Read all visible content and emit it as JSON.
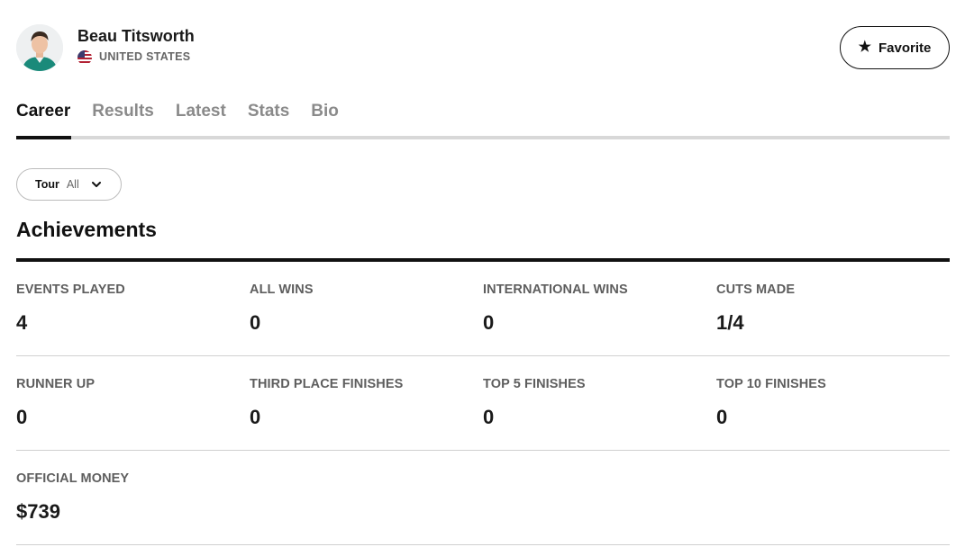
{
  "player": {
    "name": "Beau Titsworth",
    "country": "UNITED STATES"
  },
  "actions": {
    "favorite_label": "Favorite"
  },
  "tabs": [
    {
      "label": "Career",
      "active": true
    },
    {
      "label": "Results",
      "active": false
    },
    {
      "label": "Latest",
      "active": false
    },
    {
      "label": "Stats",
      "active": false
    },
    {
      "label": "Bio",
      "active": false
    }
  ],
  "filter": {
    "label": "Tour",
    "value": "All"
  },
  "achievements": {
    "title": "Achievements",
    "rows": [
      [
        {
          "label": "EVENTS PLAYED",
          "value": "4"
        },
        {
          "label": "ALL WINS",
          "value": "0"
        },
        {
          "label": "INTERNATIONAL WINS",
          "value": "0"
        },
        {
          "label": "CUTS MADE",
          "value": "1/4"
        }
      ],
      [
        {
          "label": "RUNNER UP",
          "value": "0"
        },
        {
          "label": "THIRD PLACE FINISHES",
          "value": "0"
        },
        {
          "label": "TOP 5 FINISHES",
          "value": "0"
        },
        {
          "label": "TOP 10 FINISHES",
          "value": "0"
        }
      ],
      [
        {
          "label": "OFFICIAL MONEY",
          "value": "$739"
        }
      ]
    ]
  },
  "colors": {
    "text": "#111111",
    "muted": "#8a8a8a",
    "divider": "#d0d0d0",
    "flag_red": "#b22234",
    "flag_blue": "#3c3b6e",
    "avatar_shirt": "#1a8a7a"
  }
}
